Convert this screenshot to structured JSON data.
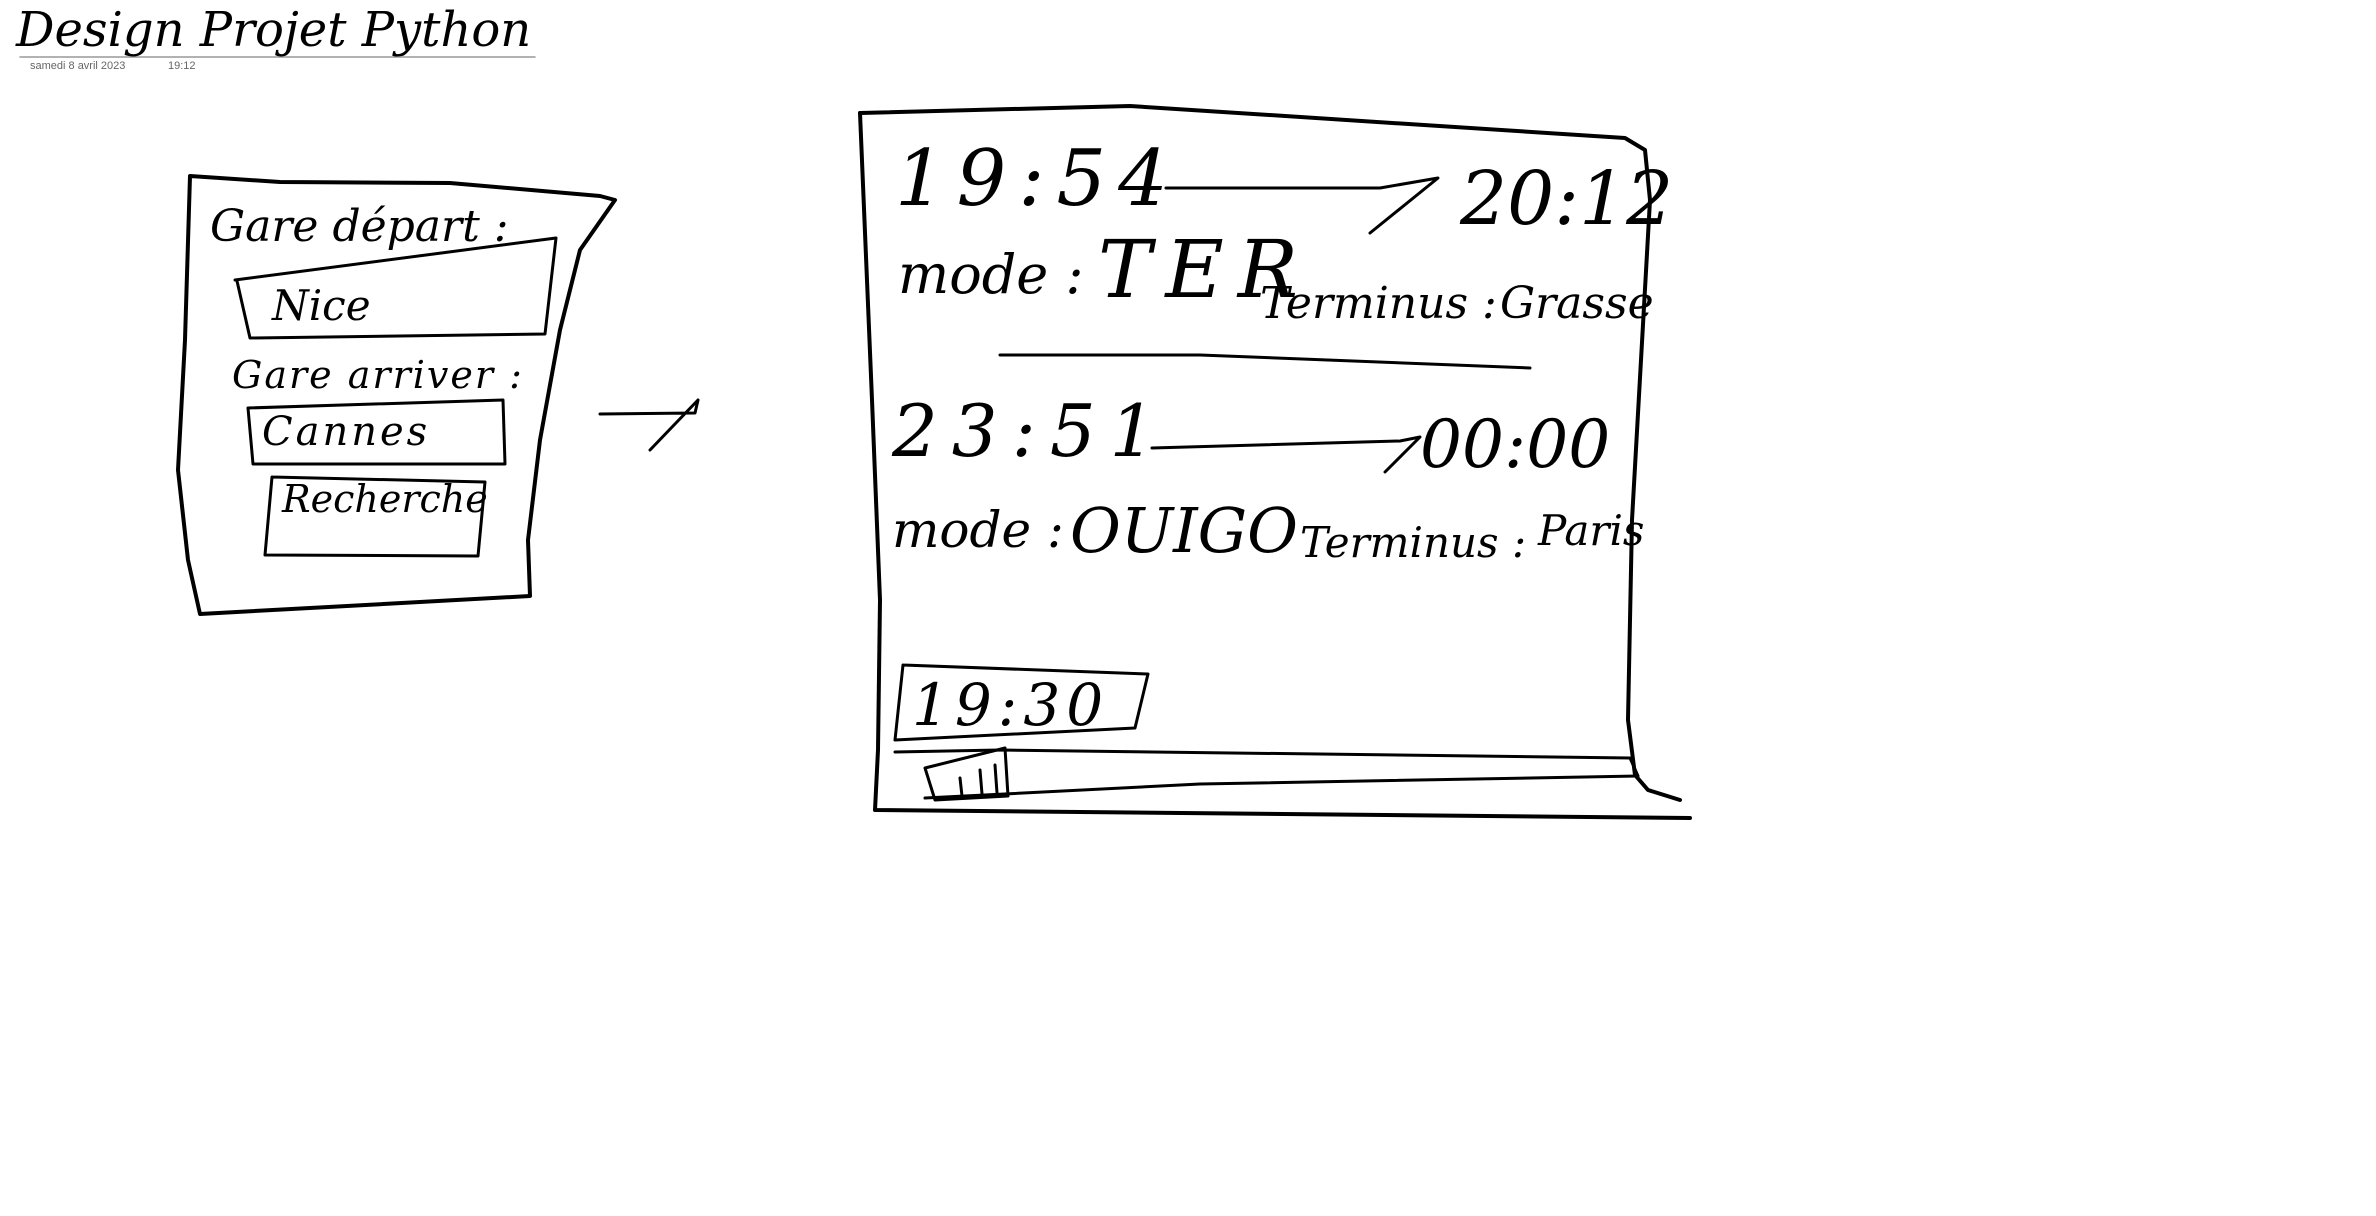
{
  "page": {
    "title": "Design Projet Python",
    "date": "samedi 8 avril 2023",
    "time": "19:12"
  },
  "search_form": {
    "departure_label": "Gare départ :",
    "departure_value": "Nice",
    "arrival_label": "Gare arriver :",
    "arrival_value": "Cannes",
    "search_button": "Recherche"
  },
  "results": {
    "trains": [
      {
        "departure_time": "19:54",
        "arrival_time": "20:12",
        "mode_label": "mode :",
        "mode": "TER",
        "terminus_label": "Terminus :",
        "terminus": "Grasse"
      },
      {
        "departure_time": "23:51",
        "arrival_time": "00:00",
        "mode_label": "mode :",
        "mode": "OUIGO",
        "terminus_label": "Terminus :",
        "terminus": "Paris"
      }
    ],
    "slider_time": "19:30"
  }
}
